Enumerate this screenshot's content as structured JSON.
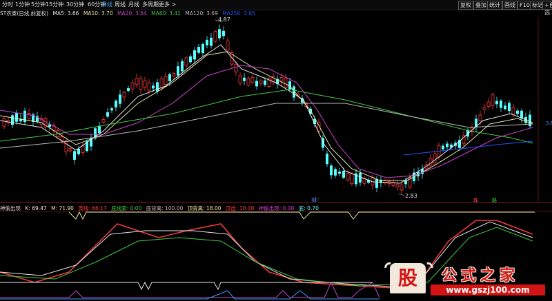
{
  "toolbar": {
    "periods": [
      "分时",
      "1分钟",
      "5分钟",
      "15分钟",
      "30分钟",
      "60分钟",
      "日线",
      "周线",
      "月线",
      "多周期",
      "更多 >"
    ],
    "active_period": "日线",
    "right_buttons": [
      "复权",
      "叠加",
      "统计",
      "画线",
      "F10",
      "标记",
      "+自选"
    ]
  },
  "main_info": {
    "stock": "ST农泰(日线,前复权)",
    "ma5": "MA5: 3.66",
    "ma10": "MA10: 3.70",
    "ma20": "MA20: 3.64",
    "ma60": "MA60: 3.41",
    "ma120": "MA120: 3.69",
    "ma250": "MA250: 3.65"
  },
  "price_annotations": {
    "high": "4.87",
    "low": "2.83",
    "right_axis": "3.6"
  },
  "signals": {
    "buy1": "财",
    "buy2": "珠",
    "buy3": "路"
  },
  "indicator_info": {
    "name": "神偷出现",
    "k": "K: 69.47",
    "m": "M: 71.90",
    "gold": "黄线: 66.17",
    "bottom_clue": "底线索: 0.00",
    "bottom_high": "底背离: 100.00",
    "top_divergence": "顶背离: 18.00",
    "top_out": "顶出: 10.00",
    "thief": "神偷出现: 0.00",
    "bottom": "底: 0.70"
  },
  "colors": {
    "up": "#ff3b3b",
    "down": "#54ffff",
    "ma5": "#e8e8e8",
    "ma10": "#e8e8a0",
    "ma20": "#cc44cc",
    "ma60": "#44cc44",
    "ma120": "#bbbbbb",
    "ma250": "#2255ff"
  },
  "watermark": {
    "logo_char": "股",
    "site_name": "公式之家",
    "url": "www.gszj100.com"
  }
}
